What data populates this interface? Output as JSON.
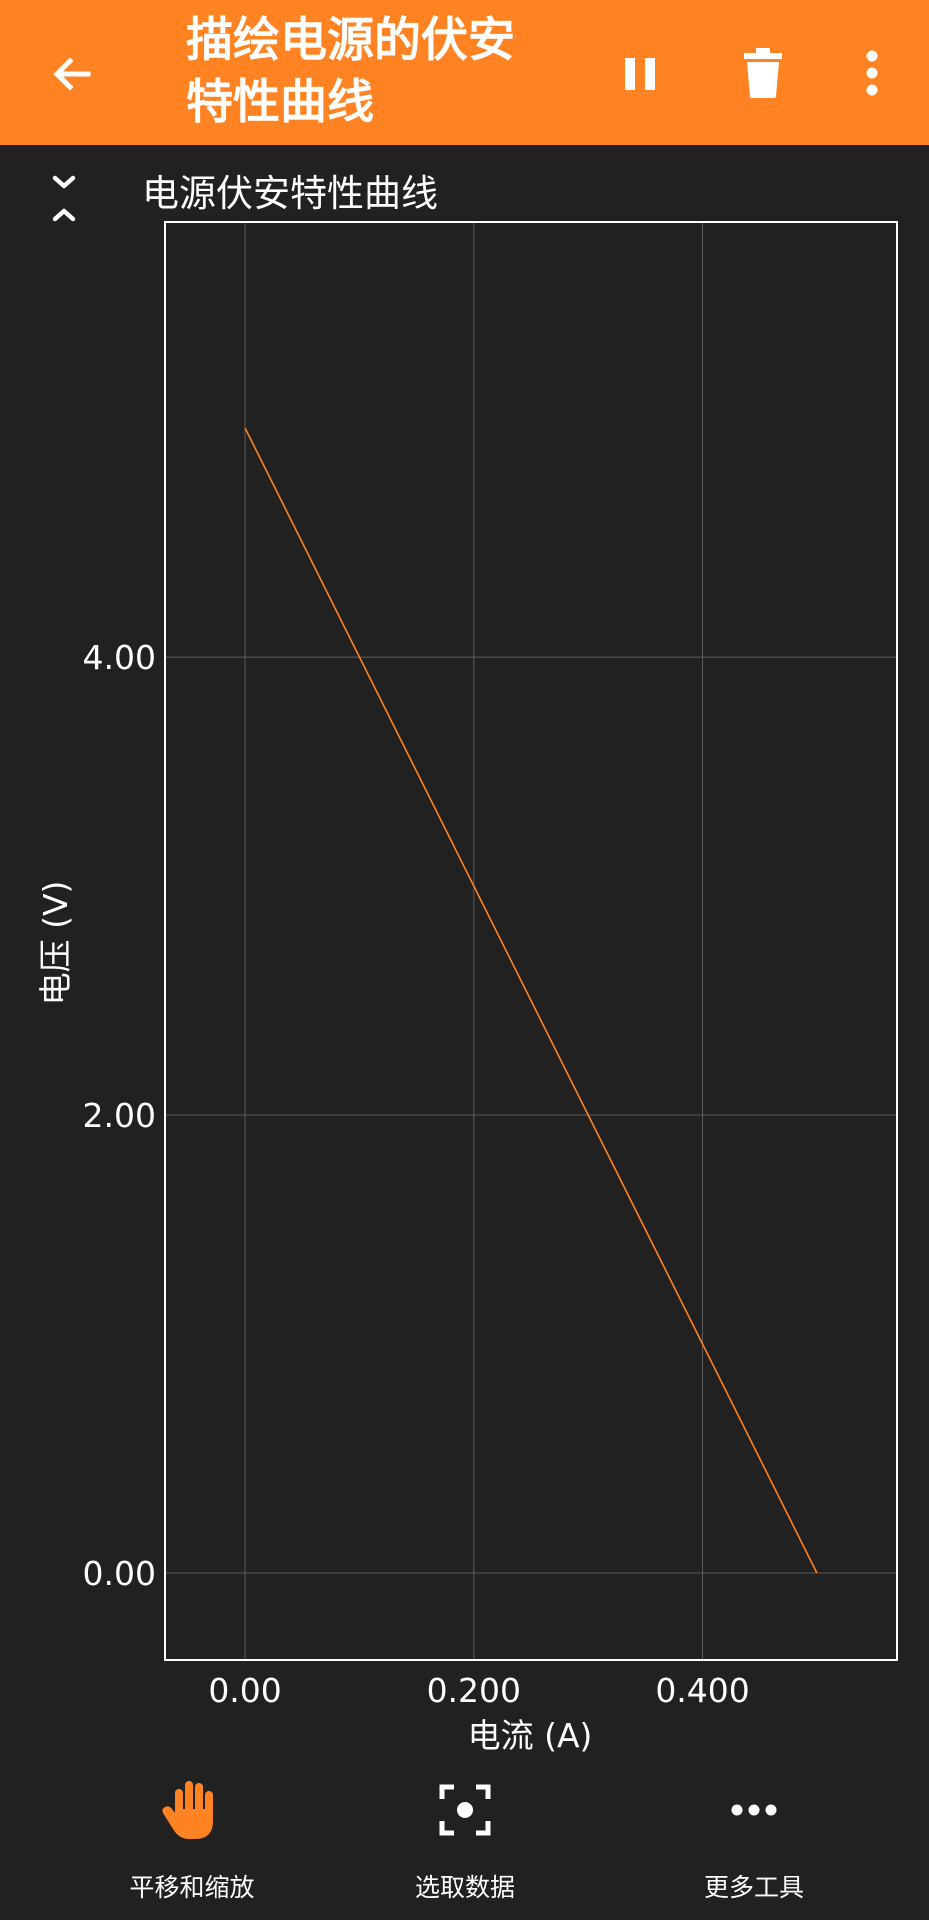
{
  "appbar": {
    "title_line1": "描绘电源的伏安",
    "title_line2": "特性曲线",
    "accent_color": "#ff8322",
    "icons": [
      "back-arrow-icon",
      "pause-icon",
      "trash-icon",
      "more-vert-icon"
    ]
  },
  "chart_title": "电源伏安特性曲线",
  "chart_data": {
    "type": "line",
    "title": "电源伏安特性曲线",
    "xlabel": "电流 (A)",
    "ylabel": "电压 (V)",
    "xlim": [
      -0.07,
      0.57
    ],
    "ylim": [
      -0.38,
      5.9
    ],
    "xticks": [
      0.0,
      0.2,
      0.4
    ],
    "xtick_labels": [
      "0.00",
      "0.200",
      "0.400"
    ],
    "yticks": [
      0.0,
      2.0,
      4.0
    ],
    "ytick_labels": [
      "0.00",
      "2.00",
      "4.00"
    ],
    "grid": true,
    "series": [
      {
        "color": "#ff8322",
        "x": [
          0.0,
          0.5
        ],
        "y": [
          5.0,
          0.0
        ]
      }
    ]
  },
  "toolbar": {
    "pan_label": "平移和缩放",
    "select_label": "选取数据",
    "more_label": "更多工具",
    "icons": [
      "hand-icon",
      "select-data-icon",
      "more-horiz-icon"
    ]
  }
}
